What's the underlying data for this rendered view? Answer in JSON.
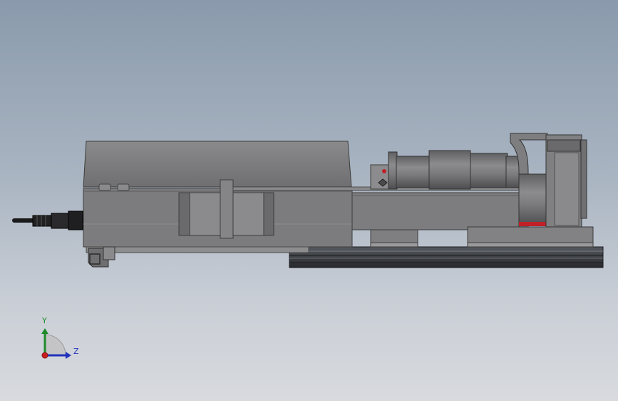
{
  "viewport": {
    "background_top": "#8a9aac",
    "background_bottom": "#d8dade"
  },
  "triad": {
    "y_label": "Y",
    "z_label": "Z",
    "y_color": "#1d8a2a",
    "z_color": "#2233bb",
    "x_color": "#c81e1e"
  },
  "model": {
    "body_color": "#7e7e80",
    "edge_color": "#3c3c3c",
    "rail_color": "#2f3136",
    "accent_red": "#c02028",
    "cable_color": "#1a1a1a"
  }
}
